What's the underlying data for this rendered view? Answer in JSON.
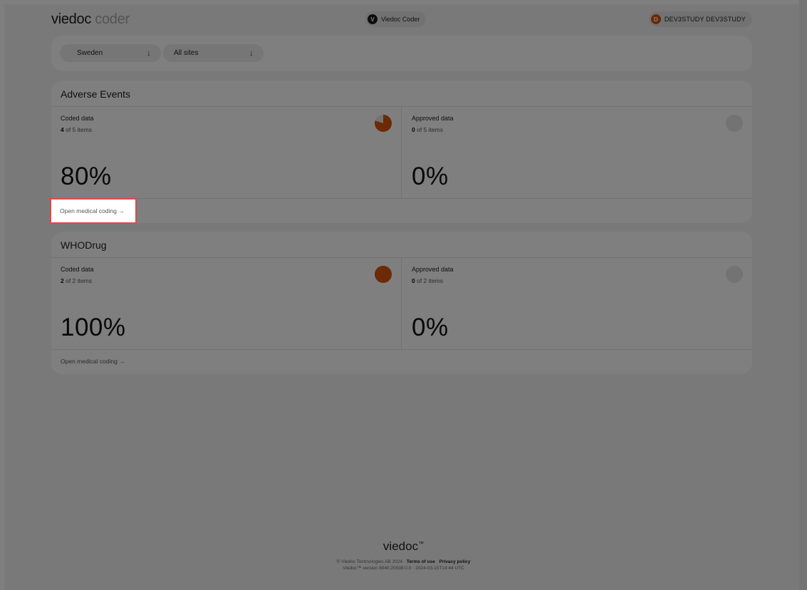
{
  "header": {
    "logo_main": "viedoc",
    "logo_sub": "coder",
    "app_pill": {
      "initial": "V",
      "label": "Viedoc Coder"
    },
    "user_pill": {
      "initial": "D",
      "label": "DEV3STUDY DEV3STUDY"
    }
  },
  "filters": {
    "country": {
      "value": "Sweden",
      "arrow": "↓"
    },
    "site": {
      "value": "All sites",
      "arrow": "↓"
    }
  },
  "cards": [
    {
      "title": "Adverse Events",
      "coded": {
        "label": "Coded data",
        "count": "4",
        "of_text": " of 5 items",
        "percent": "80%",
        "fraction": 0.8
      },
      "approved": {
        "label": "Approved data",
        "count": "0",
        "of_text": " of 5 items",
        "percent": "0%",
        "fraction": 0.0
      },
      "link": "Open medical coding →"
    },
    {
      "title": "WHODrug",
      "coded": {
        "label": "Coded data",
        "count": "2",
        "of_text": " of 2 items",
        "percent": "100%",
        "fraction": 1.0
      },
      "approved": {
        "label": "Approved data",
        "count": "0",
        "of_text": " of 2 items",
        "percent": "0%",
        "fraction": 0.0
      },
      "link": "Open medical coding →"
    }
  ],
  "footer": {
    "logo": "viedoc",
    "logo_mark": "™",
    "copyright": "© Viedoc Technologies AB 2024",
    "sep": "·",
    "terms": "Terms of use",
    "privacy": "Privacy policy",
    "version": "Viedoc™ version 8840.20938.0.0",
    "timestamp": "2024-03-15T14:44 UTC"
  },
  "colors": {
    "accent": "#d9540c",
    "pie_empty": "#e6e6e6",
    "highlight": "#e04848"
  }
}
